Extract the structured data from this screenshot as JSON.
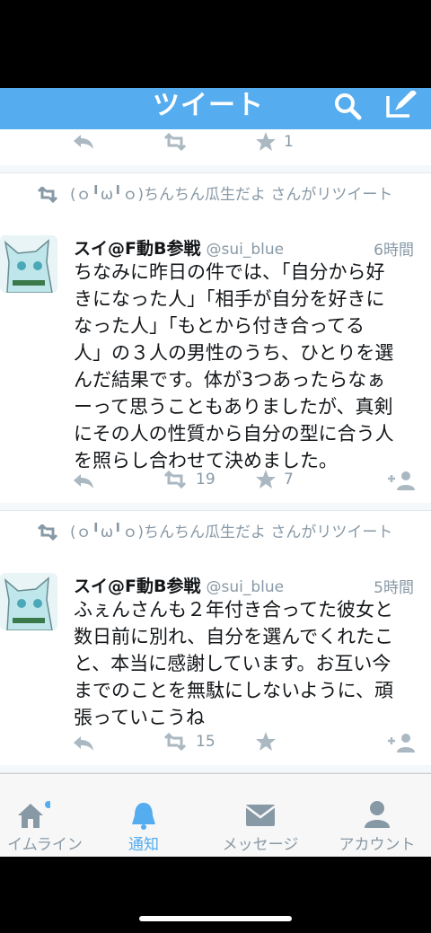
{
  "header": {
    "title": "ツイート"
  },
  "top_actions": {
    "fav_count": "1"
  },
  "tweets": [
    {
      "retweeted_by": "(ｏ╹ω╹ｏ)ちんちん瓜生だよ さんがリツイート",
      "name": "スイ@F動B参戦",
      "handle": "@sui_blue",
      "time": "6時間",
      "lines": [
        "ちなみに昨日の件では、「自分から好",
        "きになった人」「相手が自分を好きに",
        "なった人」「もとから付き合ってる",
        "人」の３人の男性のうち、ひとりを選",
        "んだ結果です。体が3つあったらなぁ",
        "ーって思うこともありましたが、真剣",
        "にその人の性質から自分の型に合う人",
        "を照らし合わせて決めました。"
      ],
      "retweets": "19",
      "favorites": "7"
    },
    {
      "retweeted_by": "(ｏ╹ω╹ｏ)ちんちん瓜生だよ さんがリツイート",
      "name": "スイ@F動B参戦",
      "handle": "@sui_blue",
      "time": "5時間",
      "lines": [
        "ふぇんさんも２年付き合ってた彼女と",
        "数日前に別れ、自分を選んでくれたこ",
        "と、本当に感謝しています。お互い今",
        "までのことを無駄にしないように、頑",
        "張っていこうね"
      ],
      "retweets": "15",
      "favorites": ""
    }
  ],
  "tabbar": {
    "tabs": [
      {
        "label": "イムライン",
        "icon": "home-icon",
        "active": false
      },
      {
        "label": "通知",
        "icon": "bell-icon",
        "active": true
      },
      {
        "label": "メッセージ",
        "icon": "envelope-icon",
        "active": false
      },
      {
        "label": "アカウント",
        "icon": "person-icon",
        "active": false
      }
    ]
  },
  "colors": {
    "brand": "#55acee",
    "text": "#14171a",
    "muted": "#8899a6",
    "icon": "#aab8c2"
  }
}
